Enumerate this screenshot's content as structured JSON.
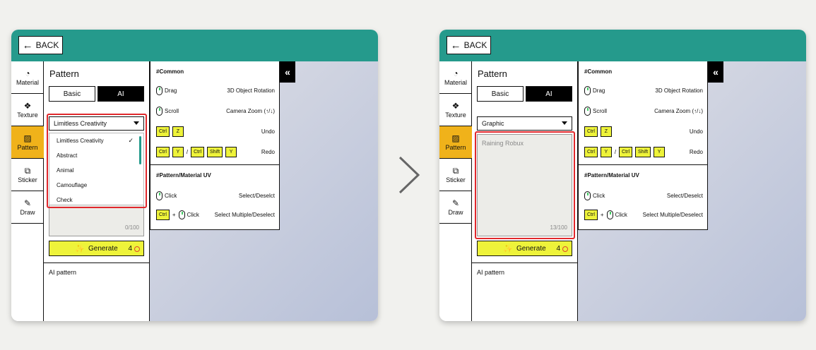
{
  "back_label": "BACK",
  "sidebar": [
    {
      "label": "Material",
      "icon": "material-icon",
      "glyph": "◔"
    },
    {
      "label": "Texture",
      "icon": "texture-icon",
      "glyph": "❖"
    },
    {
      "label": "Pattern",
      "icon": "pattern-icon",
      "glyph": "▨"
    },
    {
      "label": "Sticker",
      "icon": "sticker-icon",
      "glyph": "⧉"
    },
    {
      "label": "Draw",
      "icon": "pen-icon",
      "glyph": "✎"
    }
  ],
  "props": {
    "title": "Pattern",
    "tab_basic": "Basic",
    "tab_ai": "AI",
    "generate_label": "Generate",
    "generate_cost": "4",
    "ai_pattern_label": "AI pattern"
  },
  "left": {
    "select_value": "Limitless Creativity",
    "prompt_count": "0/100",
    "dropdown_options": [
      "Limitless Creativity",
      "Abstract",
      "Animal",
      "Camouflage",
      "Check"
    ]
  },
  "right": {
    "select_value": "Graphic",
    "prompt_text": "Raining Robux",
    "prompt_count": "13/100"
  },
  "help": {
    "common_title": "#Common",
    "drag": "Drag",
    "drag_desc": "3D Object Rotation",
    "scroll": "Scroll",
    "scroll_desc": "Camera Zoom (↑/↓)",
    "key_ctrl": "Ctrl",
    "key_z": "Z",
    "key_y": "Y",
    "key_shift": "Shift",
    "slash": "/",
    "undo": "Undo",
    "redo": "Redo",
    "uv_title": "#Pattern/Material UV",
    "click": "Click",
    "click_desc": "Select/Deselct",
    "plus": "+",
    "multi_desc": "Select Multiple/Deselect"
  },
  "collapse_glyph": "«",
  "colors": {
    "header": "#259a8c",
    "active_tab": "#f0b21a",
    "key_yellow": "#eef33a",
    "highlight": "#e0282c"
  }
}
